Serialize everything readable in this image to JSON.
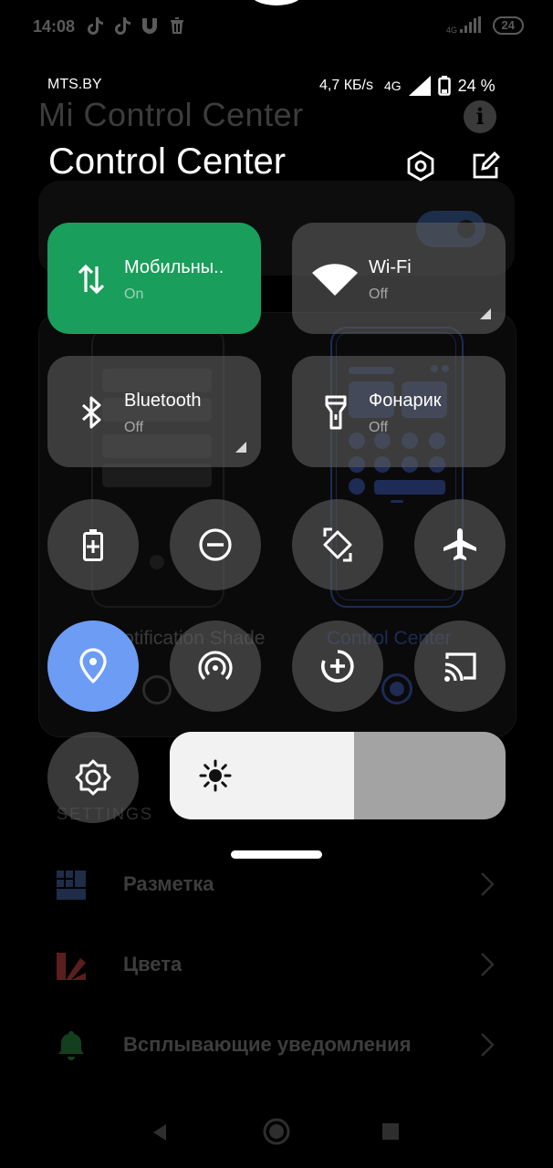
{
  "background": {
    "status": {
      "time": "14:08",
      "network": "4G",
      "battery": "24"
    },
    "title": "Mi Control Center",
    "styles": {
      "left_label": "Notification Shade",
      "right_label": "Control Center",
      "selected": "Control Center"
    },
    "settings_header": "SETTINGS",
    "settings_items": [
      {
        "label": "Разметка",
        "icon": "grid-icon"
      },
      {
        "label": "Цвета",
        "icon": "palette-icon"
      },
      {
        "label": "Всплывающие уведомления",
        "icon": "bell-icon"
      }
    ]
  },
  "status_bar": {
    "carrier": "MTS.BY",
    "speed": "4,7 КБ/s",
    "network": "4G",
    "battery_percent": "24 %"
  },
  "control_center": {
    "title": "Control Center",
    "settings_icon": "settings-icon",
    "edit_icon": "edit-icon",
    "tiles": [
      {
        "id": "mobile-data",
        "label": "Мобильны..",
        "state": "On",
        "icon": "mobile-data-icon",
        "active": true
      },
      {
        "id": "wifi",
        "label": "Wi-Fi",
        "state": "Off",
        "icon": "wifi-icon",
        "active": false
      },
      {
        "id": "bluetooth",
        "label": "Bluetooth",
        "state": "Off",
        "icon": "bluetooth-icon",
        "active": false
      },
      {
        "id": "flashlight",
        "label": "Фонарик",
        "state": "Off",
        "icon": "flashlight-icon",
        "active": false
      }
    ],
    "toggles": [
      {
        "id": "battery-saver",
        "icon": "battery-saver-icon",
        "active": false
      },
      {
        "id": "dnd",
        "icon": "do-not-disturb-icon",
        "active": false
      },
      {
        "id": "auto-rotate",
        "icon": "auto-rotate-icon",
        "active": false
      },
      {
        "id": "airplane",
        "icon": "airplane-icon",
        "active": false
      },
      {
        "id": "location",
        "icon": "location-icon",
        "active": true
      },
      {
        "id": "hotspot",
        "icon": "hotspot-icon",
        "active": false
      },
      {
        "id": "data-saver",
        "icon": "data-saver-icon",
        "active": false
      },
      {
        "id": "cast",
        "icon": "cast-icon",
        "active": false
      },
      {
        "id": "auto-brightness",
        "icon": "auto-brightness-icon",
        "active": false
      }
    ],
    "brightness": {
      "level": 0.55,
      "icon": "sun-icon"
    }
  },
  "nav": {
    "back": "back-icon",
    "home": "home-icon",
    "recents": "recents-icon"
  },
  "colors": {
    "active_green": "#1a9e5b",
    "location_blue": "#6c9cf4",
    "tile_gray": "#5c5c5c"
  }
}
